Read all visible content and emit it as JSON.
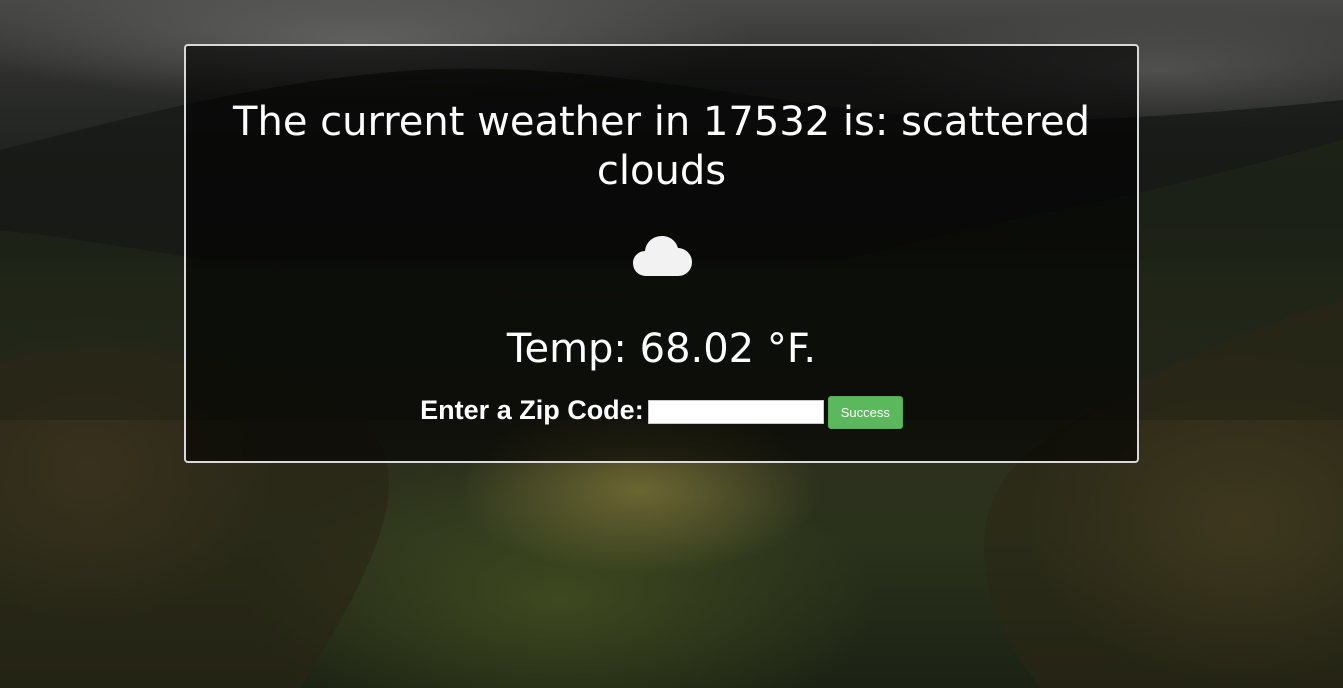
{
  "weather": {
    "headline": "The current weather in 17532 is: scattered clouds",
    "condition_icon": "cloud-icon",
    "temp_label": "Temp: 68.02 °F."
  },
  "zip_form": {
    "label": "Enter a Zip Code:",
    "input_value": "",
    "submit_label": "Success"
  },
  "colors": {
    "panel_border": "#d9d9d9",
    "button": "#5cb85c",
    "text": "#ffffff"
  }
}
